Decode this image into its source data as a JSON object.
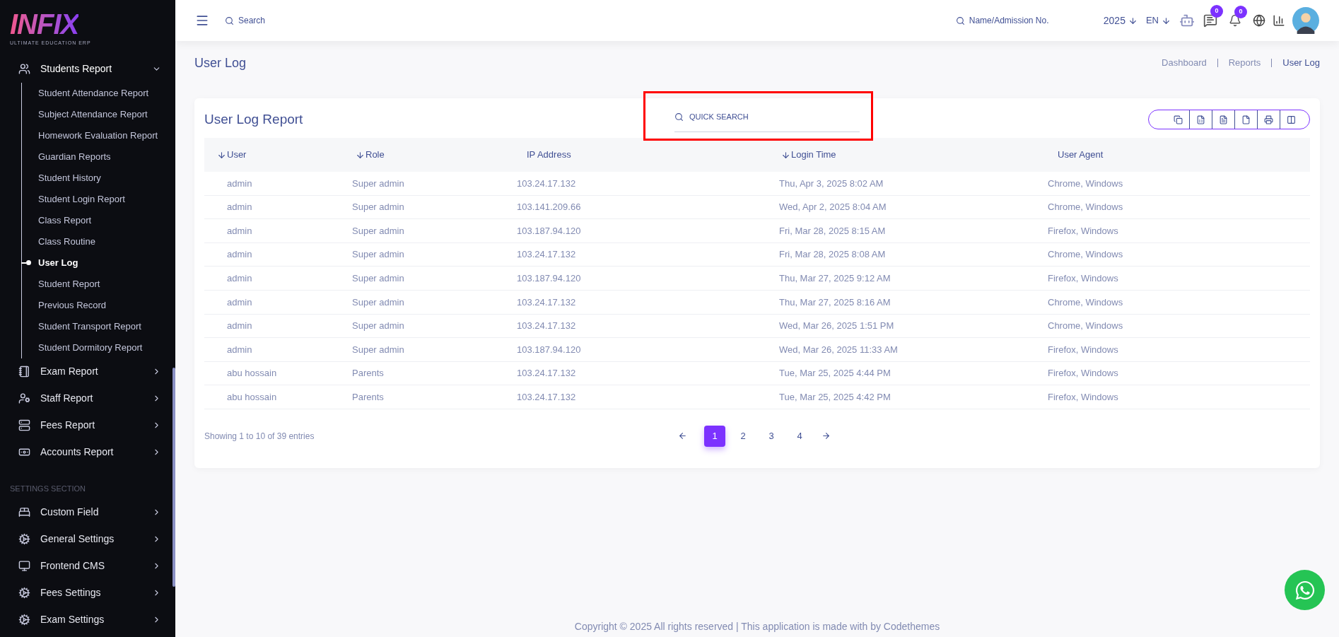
{
  "sidebar": {
    "logo": {
      "wordmark": "INFIX",
      "tagline": "ULTIMATE EDUCATION ERP"
    },
    "groups": [
      {
        "label": "Students Report",
        "expanded": true,
        "children": [
          {
            "label": "Student Attendance Report",
            "selected": false
          },
          {
            "label": "Subject Attendance Report",
            "selected": false
          },
          {
            "label": "Homework Evaluation Report",
            "selected": false
          },
          {
            "label": "Guardian Reports",
            "selected": false
          },
          {
            "label": "Student History",
            "selected": false
          },
          {
            "label": "Student Login Report",
            "selected": false
          },
          {
            "label": "Class Report",
            "selected": false
          },
          {
            "label": "Class Routine",
            "selected": false
          },
          {
            "label": "User Log",
            "selected": true
          },
          {
            "label": "Student Report",
            "selected": false
          },
          {
            "label": "Previous Record",
            "selected": false
          },
          {
            "label": "Student Transport Report",
            "selected": false
          },
          {
            "label": "Student Dormitory Report",
            "selected": false
          }
        ]
      },
      {
        "label": "Exam Report",
        "expanded": false
      },
      {
        "label": "Staff Report",
        "expanded": false
      },
      {
        "label": "Fees Report",
        "expanded": false
      },
      {
        "label": "Accounts Report",
        "expanded": false
      }
    ],
    "section_label": "SETTINGS SECTION",
    "settings_items": [
      {
        "label": "Custom Field",
        "expanded": false
      },
      {
        "label": "General Settings",
        "expanded": false
      },
      {
        "label": "Frontend CMS",
        "expanded": false
      },
      {
        "label": "Fees Settings",
        "expanded": false
      },
      {
        "label": "Exam Settings",
        "expanded": false
      }
    ]
  },
  "topbar": {
    "search_placeholder": "Search",
    "admission_placeholder": "Name/Admission No.",
    "year": "2025",
    "language": "EN",
    "messages_count": "0",
    "notifications_count": "0"
  },
  "page_title": "User Log",
  "breadcrumb": [
    {
      "label": "Dashboard",
      "selected": false
    },
    {
      "label": "Reports",
      "selected": false
    },
    {
      "label": "User Log",
      "selected": true
    }
  ],
  "card": {
    "title": "User Log Report",
    "quick_search_placeholder": "QUICK SEARCH",
    "columns": [
      {
        "label": "User",
        "sortable": true
      },
      {
        "label": "Role",
        "sortable": true
      },
      {
        "label": "IP Address",
        "sortable": false
      },
      {
        "label": "Login Time",
        "sortable": true
      },
      {
        "label": "User Agent",
        "sortable": false
      }
    ],
    "rows": [
      [
        "admin",
        "Super admin",
        "103.24.17.132",
        "Thu, Apr 3, 2025 8:02 AM",
        "Chrome, Windows"
      ],
      [
        "admin",
        "Super admin",
        "103.141.209.66",
        "Wed, Apr 2, 2025 8:04 AM",
        "Chrome, Windows"
      ],
      [
        "admin",
        "Super admin",
        "103.187.94.120",
        "Fri, Mar 28, 2025 8:15 AM",
        "Firefox, Windows"
      ],
      [
        "admin",
        "Super admin",
        "103.24.17.132",
        "Fri, Mar 28, 2025 8:08 AM",
        "Chrome, Windows"
      ],
      [
        "admin",
        "Super admin",
        "103.187.94.120",
        "Thu, Mar 27, 2025 9:12 AM",
        "Firefox, Windows"
      ],
      [
        "admin",
        "Super admin",
        "103.24.17.132",
        "Thu, Mar 27, 2025 8:16 AM",
        "Chrome, Windows"
      ],
      [
        "admin",
        "Super admin",
        "103.24.17.132",
        "Wed, Mar 26, 2025 1:51 PM",
        "Chrome, Windows"
      ],
      [
        "admin",
        "Super admin",
        "103.187.94.120",
        "Wed, Mar 26, 2025 11:33 AM",
        "Firefox, Windows"
      ],
      [
        "abu hossain",
        "Parents",
        "103.24.17.132",
        "Tue, Mar 25, 2025 4:44 PM",
        "Firefox, Windows"
      ],
      [
        "abu hossain",
        "Parents",
        "103.24.17.132",
        "Tue, Mar 25, 2025 4:42 PM",
        "Firefox, Windows"
      ]
    ],
    "showing": "Showing 1 to 10 of 39 entries",
    "pages": [
      {
        "label": "1",
        "selected": true
      },
      {
        "label": "2",
        "selected": false
      },
      {
        "label": "3",
        "selected": false
      },
      {
        "label": "4",
        "selected": false
      }
    ]
  },
  "footer": "Copyright © 2025 All rights reserved | This application is made with by Codethemes"
}
